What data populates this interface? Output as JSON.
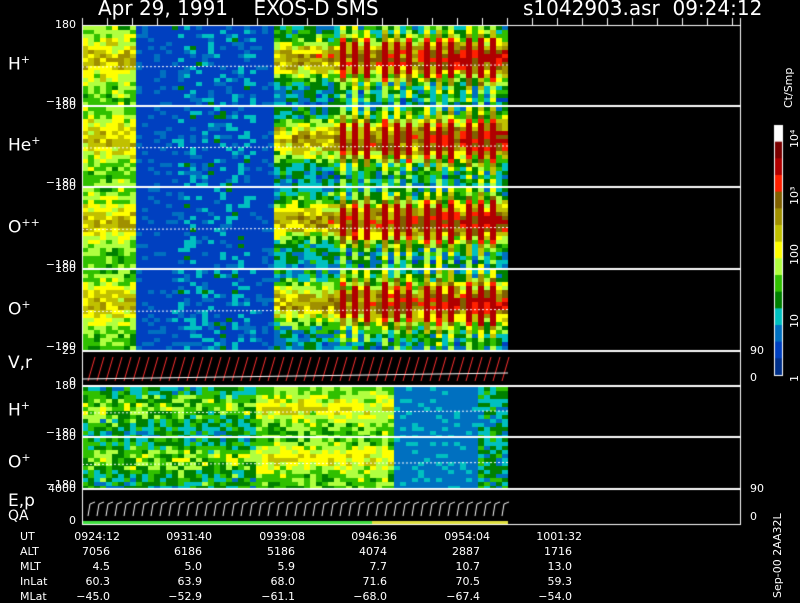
{
  "header": {
    "title": "Apr 29, 1991    EXOS-D SMS",
    "file_time": "s1042903.asr  09:24:12"
  },
  "channels": [
    {
      "label": "H",
      "sup": "+",
      "ymax": "180",
      "ymin": "−180"
    },
    {
      "label": "He",
      "sup": "+",
      "ymax": "180",
      "ymin": "−180"
    },
    {
      "label": "O",
      "sup": "++",
      "ymax": "180",
      "ymin": "−180"
    },
    {
      "label": "O",
      "sup": "+",
      "ymax": "180",
      "ymin": "−180"
    },
    {
      "label": "V,r",
      "sup": "",
      "ymax": "25",
      "ymin": "0",
      "rtop": "90",
      "rbot": "0"
    },
    {
      "label": "H",
      "sup": "+",
      "ymax": "180",
      "ymin": "−180"
    },
    {
      "label": "O",
      "sup": "+",
      "ymax": "180",
      "ymin": "−180"
    },
    {
      "label": "E,p",
      "sup": "",
      "ymax": "4000",
      "ymin": "0",
      "rtop": "90",
      "rbot": "0"
    }
  ],
  "qa_label": "QA",
  "colorbar": {
    "title": "Ct/Smp",
    "ticks": [
      "10⁴",
      "10³",
      "100",
      "10",
      "1"
    ],
    "colors": [
      "#ffffff",
      "#7a0000",
      "#b00000",
      "#ff2000",
      "#806000",
      "#a09000",
      "#c0c000",
      "#ffff00",
      "#b0ff40",
      "#30c000",
      "#008000",
      "#00c0c0",
      "#0070c0",
      "#0040c0",
      "#00308a"
    ]
  },
  "side_label": "Sep-00  2AA32L",
  "time_axis": {
    "rows": [
      {
        "label": "UT",
        "values": [
          "0924:12",
          "0931:40",
          "0939:08",
          "0946:36",
          "0954:04",
          "1001:32"
        ]
      },
      {
        "label": "ALT",
        "values": [
          "7056",
          "6186",
          "5186",
          "4074",
          "2887",
          "1716"
        ]
      },
      {
        "label": "MLT",
        "values": [
          "4.5",
          "5.0",
          "5.9",
          "7.7",
          "10.7",
          "13.0"
        ]
      },
      {
        "label": "InLat",
        "values": [
          "60.3",
          "63.9",
          "68.0",
          "71.6",
          "70.5",
          "59.3"
        ]
      },
      {
        "label": "MLat",
        "values": [
          "−45.0",
          "−52.9",
          "−61.1",
          "−68.0",
          "−67.4",
          "−54.0"
        ]
      }
    ]
  },
  "chart_data": {
    "type": "heatmap",
    "title": "Apr 29, 1991    EXOS-D SMS",
    "xlabel": "UT",
    "x_ticks": [
      "0924:12",
      "0931:40",
      "0939:08",
      "0946:36",
      "0954:04",
      "1001:32"
    ],
    "panels": [
      "H+",
      "He+",
      "O++",
      "O+",
      "V,r",
      "H+",
      "O+",
      "E,p"
    ],
    "ylim_pitch": [
      -180,
      180
    ],
    "ylim_vr": [
      0,
      25
    ],
    "ylim_ep": [
      0,
      4000
    ],
    "colorscale": "log",
    "colorscale_range": [
      1,
      10000
    ]
  }
}
